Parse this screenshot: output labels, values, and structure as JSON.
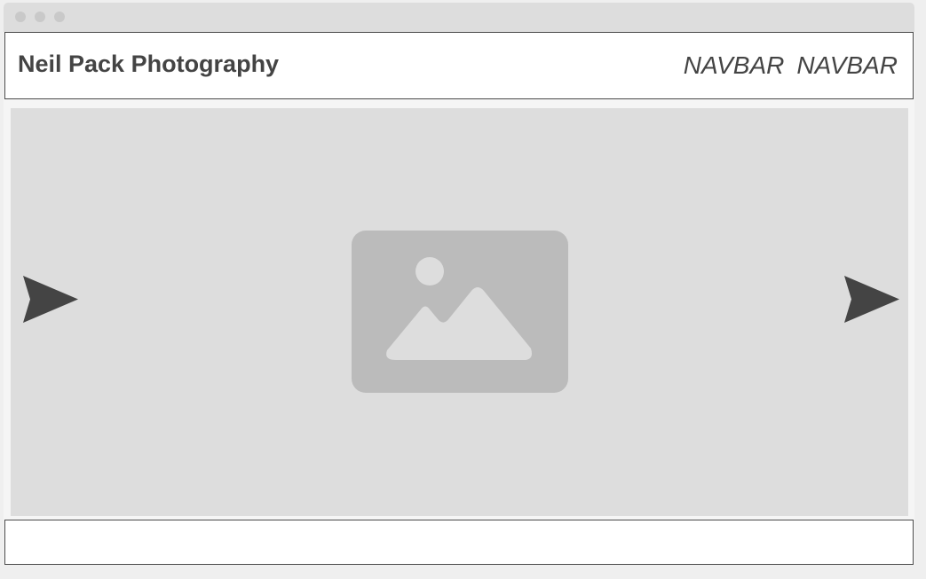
{
  "header": {
    "site_title": "Neil Pack Photography",
    "nav": [
      "NAVBAR",
      "NAVBAR"
    ]
  },
  "carousel": {
    "image": "image-placeholder-icon",
    "prev_icon": "arrow-icon",
    "next_icon": "arrow-icon"
  },
  "colors": {
    "text": "#444444",
    "placeholder_bg": "#dddddd",
    "placeholder_icon": "#bbbbbb",
    "arrow": "#444444"
  }
}
